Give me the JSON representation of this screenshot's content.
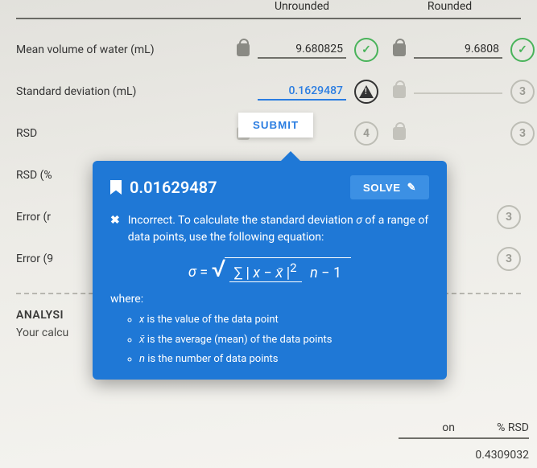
{
  "headers": {
    "unrounded": "Unrounded",
    "rounded": "Rounded"
  },
  "rows": {
    "mean": {
      "label": "Mean volume of water (mL)",
      "unrounded": "9.680825",
      "rounded": "9.6808"
    },
    "stddev": {
      "label": "Standard deviation (mL)",
      "unrounded": "0.1629487",
      "rounded": "3"
    },
    "rsd": {
      "label": "RSD",
      "unrounded": "4",
      "rounded": "3"
    },
    "rsdpct": {
      "label": "RSD (%"
    },
    "err_r": {
      "label": "Error (r",
      "rounded": "3"
    },
    "err_9": {
      "label": "Error (9",
      "rounded": "3"
    }
  },
  "submit": "SUBMIT",
  "analysis": {
    "title": "ANALYSI",
    "sub": "Your calcu"
  },
  "popup": {
    "value": "0.01629487",
    "solve": "SOLVE",
    "msg_a": "Incorrect. To calculate the standard deviation ",
    "msg_sigma": "σ",
    "msg_b": " of a range of data points, use the following equation:",
    "where": "where:",
    "li1_a": "x",
    "li1_b": " is the value of the data point",
    "li2_a": "x̄",
    "li2_b": " is the average (mean) of the data points",
    "li3_a": "n",
    "li3_b": " is the number of data points"
  },
  "bottom": {
    "h1": "on",
    "h2": "% RSD",
    "v2": "0.4309032"
  }
}
